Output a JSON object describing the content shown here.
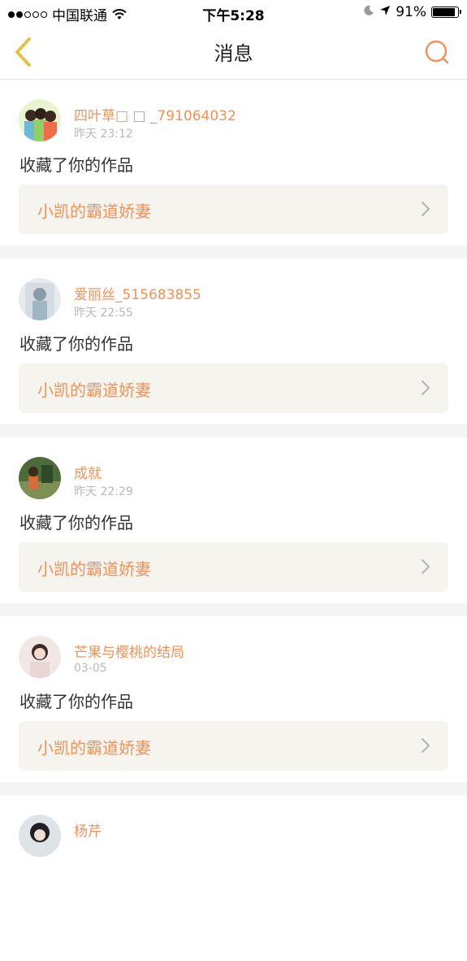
{
  "status_bar": {
    "carrier": "中国联通",
    "time": "下午5:28",
    "battery": "91%",
    "battery_level": 0.91,
    "icons": [
      "signal-dots",
      "wifi-icon",
      "moon-icon",
      "location-arrow-icon",
      "battery-icon"
    ]
  },
  "nav": {
    "title": "消息",
    "back_icon": "chevron-left-icon",
    "search_icon": "search-icon",
    "accent_color": "#f0925a",
    "back_color": "#e2c24a"
  },
  "messages": [
    {
      "user": "四叶草□ □ _791064032",
      "time": "昨天 23:12",
      "action": "收藏了你的作品",
      "work": "小凯的霸道娇妻"
    },
    {
      "user": "爱丽丝_515683855",
      "time": "昨天 22:55",
      "action": "收藏了你的作品",
      "work": "小凯的霸道娇妻"
    },
    {
      "user": "成就",
      "time": "昨天 22:29",
      "action": "收藏了你的作品",
      "work": "小凯的霸道娇妻"
    },
    {
      "user": "芒果与樱桃的结局",
      "time": "03-05",
      "action": "收藏了你的作品",
      "work": "小凯的霸道娇妻"
    },
    {
      "user": "杨芹",
      "time": "",
      "action": "",
      "work": ""
    }
  ]
}
